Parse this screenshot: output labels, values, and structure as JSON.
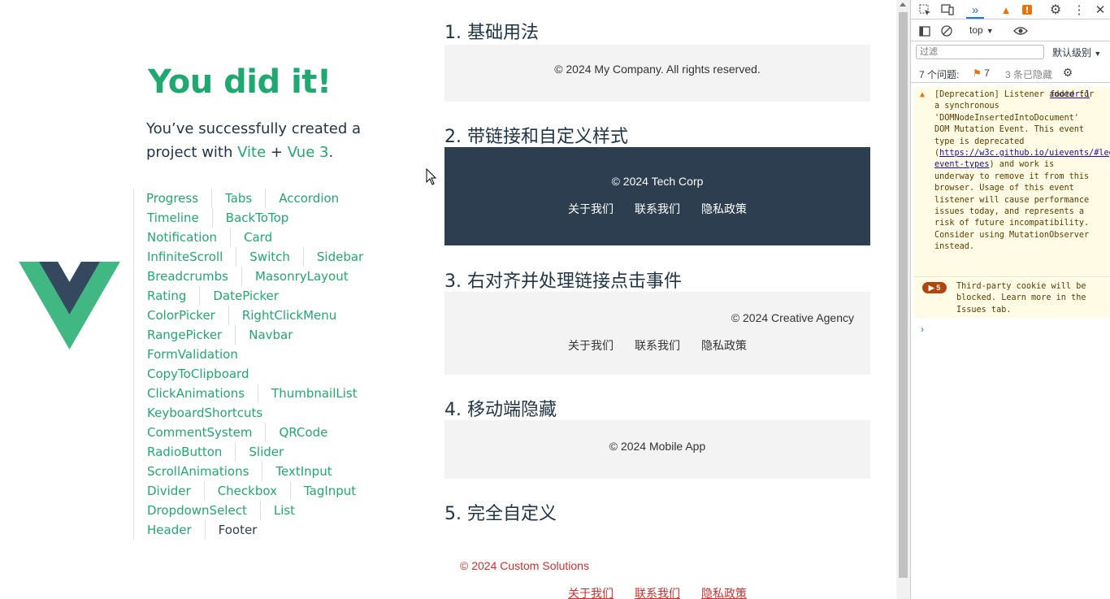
{
  "greeting": {
    "title": "You did it!",
    "line_prefix": "You’ve successfully created a project with ",
    "vite": "Vite",
    "plus": " + ",
    "vue": "Vue 3",
    "suffix": "."
  },
  "nav_rows": [
    [
      "Progress",
      "Tabs",
      "Accordion"
    ],
    [
      "Timeline",
      "BackToTop"
    ],
    [
      "Notification",
      "Card"
    ],
    [
      "InfiniteScroll",
      "Switch",
      "Sidebar"
    ],
    [
      "Breadcrumbs",
      "MasonryLayout"
    ],
    [
      "Rating",
      "DatePicker"
    ],
    [
      "ColorPicker",
      "RightClickMenu"
    ],
    [
      "RangePicker",
      "Navbar"
    ],
    [
      "FormValidation"
    ],
    [
      "CopyToClipboard"
    ],
    [
      "ClickAnimations",
      "ThumbnailList"
    ],
    [
      "KeyboardShortcuts"
    ],
    [
      "CommentSystem",
      "QRCode"
    ],
    [
      "RadioButton",
      "Slider"
    ],
    [
      "ScrollAnimations",
      "TextInput"
    ],
    [
      "Divider",
      "Checkbox",
      "TagInput"
    ],
    [
      "DropdownSelect",
      "List"
    ],
    [
      "Header",
      "Footer"
    ]
  ],
  "nav_active": "Footer",
  "demos": {
    "h1": "1. 基础用法",
    "h2": "2. 带链接和自定义样式",
    "h3": "3. 右对齐并处理链接点击事件",
    "h4": "4. 移动端隐藏",
    "h5": "5. 完全自定义",
    "copy1": "© 2024 My Company. All rights reserved.",
    "copy2": "© 2024 Tech Corp",
    "copy3": "© 2024 Creative Agency",
    "copy4": "© 2024 Mobile App",
    "copy5": "© 2024 Custom Solutions",
    "links": [
      "关于我们",
      "联系我们",
      "隐私政策"
    ]
  },
  "colors": {
    "vue_green": "#1fa870",
    "dark_footer": "#2c3e50",
    "custom_red": "#d32f2f"
  },
  "devtools": {
    "context": "top",
    "filter_placeholder": "过滤",
    "level": "默认级别",
    "issues_label": "7 个问题:",
    "issues_badge": "7",
    "hidden": "3 条已隐藏",
    "warning_source": "footer:1",
    "warning_text_1": "[Deprecation] Listener added for a synchronous 'DOMNodeInsertedIntoDocument' DOM Mutation Event. This event type is deprecated (",
    "warning_link": "https://w3c.github.io/uievents/#legacy-event-types",
    "warning_text_2": ") and work is underway to remove it from this browser. Usage of this event listener will cause performance issues today, and represents a risk of future incompatibility. Consider using MutationObserver instead.",
    "info_count": "5",
    "info_text": "Third-party cookie will be blocked. Learn more in the Issues tab.",
    "prompt": "›"
  }
}
